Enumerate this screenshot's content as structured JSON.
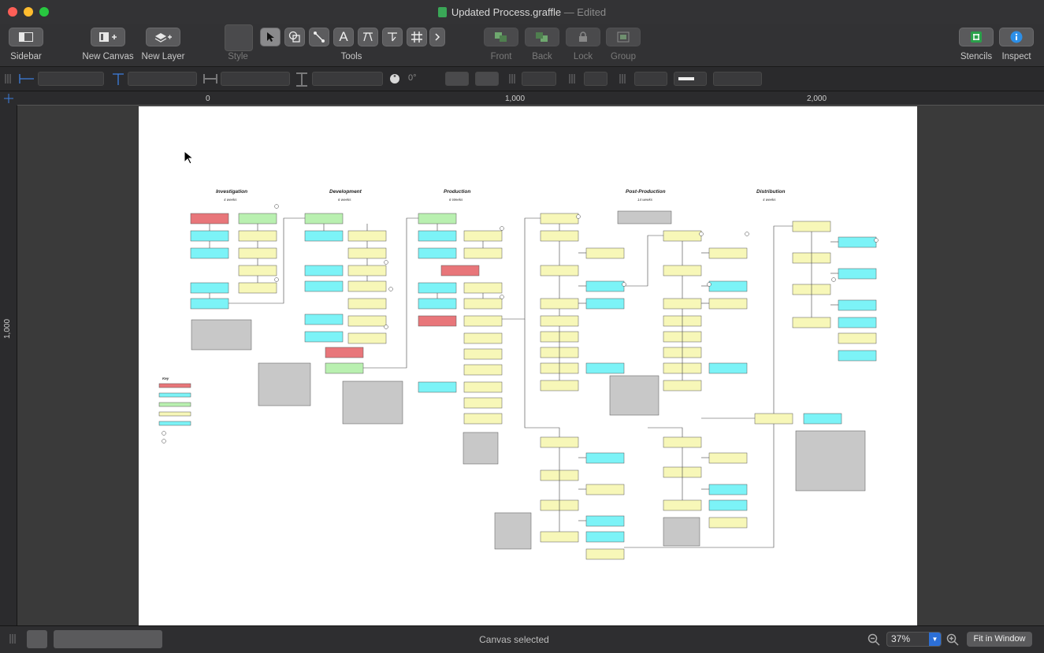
{
  "window": {
    "title": "Updated Process.graffle",
    "edited": "— Edited"
  },
  "toolbar": {
    "sidebar": "Sidebar",
    "new_canvas": "New Canvas",
    "new_layer": "New Layer",
    "style": "Style",
    "tools": "Tools",
    "front": "Front",
    "back": "Back",
    "lock": "Lock",
    "group": "Group",
    "stencils": "Stencils",
    "inspect": "Inspect",
    "text_tool_glyph": "A"
  },
  "inspector": {
    "rotation": "0°"
  },
  "ruler": {
    "top": [
      "0",
      "1,000",
      "2,000"
    ],
    "left": [
      "1,000"
    ]
  },
  "diagram": {
    "phases": [
      {
        "name": "Investigation",
        "duration": "4 weeks"
      },
      {
        "name": "Development",
        "duration": "6 weeks"
      },
      {
        "name": "Production",
        "duration": "6 Weeks"
      },
      {
        "name": "Post-Production",
        "duration": "14 weeks"
      },
      {
        "name": "Distribution",
        "duration": "4 weeks"
      }
    ],
    "key_title": "Key"
  },
  "status": {
    "text": "Canvas selected",
    "zoom": "37%",
    "fit": "Fit in Window"
  },
  "colors": {
    "red": "#e8767a",
    "green": "#b9f0b0",
    "cyan": "#7cf3f7",
    "yellow": "#f7f7b8",
    "gray": "#c8c8c8",
    "close": "#fe5f57",
    "minimize": "#febc2e",
    "maximize": "#28c840",
    "accent": "#2c6fd6"
  }
}
